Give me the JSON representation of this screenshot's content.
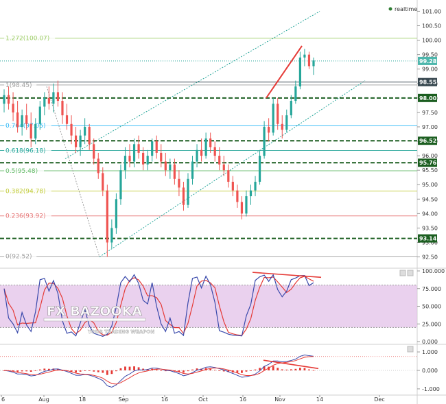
{
  "realtime_label": "realtime",
  "watermark": {
    "brand": "FX BAZOOKA",
    "tagline": "YOUR TRADING WEAPON"
  },
  "colors": {
    "up": "#26a69a",
    "down": "#ef5350",
    "support": "#1b5e20",
    "channel": "#26a69a",
    "trend_red": "#e53935",
    "stoch_k": "#3949ab",
    "stoch_d": "#e53935",
    "stoch_band": "#e1bee7"
  },
  "chart_data": [
    {
      "type": "candlestick",
      "name": "price",
      "y_ticks": [
        "101.00",
        "100.50",
        "100.00",
        "99.50",
        "99.00",
        "98.50",
        "98.00",
        "97.50",
        "97.00",
        "96.50",
        "96.00",
        "95.50",
        "95.00",
        "94.50",
        "94.00",
        "93.50",
        "93.00",
        "92.50"
      ],
      "ylim": [
        92.3,
        101.2
      ],
      "x_ticks": [
        "6",
        "Aug",
        "18",
        "Sep",
        "16",
        "Oct",
        "16",
        "Nov",
        "14",
        "Dec"
      ],
      "last_price": "99.28",
      "fib_levels": [
        {
          "label": "1.272(100.07)",
          "value": 100.07,
          "color": "#9ccc65"
        },
        {
          "label": "1(98.45)",
          "value": 98.45,
          "color": "#9e9e9e"
        },
        {
          "label": "0.764(97.05)",
          "value": 97.05,
          "color": "#29b6f6"
        },
        {
          "label": "0.618(96.18)",
          "value": 96.18,
          "color": "#26a69a"
        },
        {
          "label": "0.5(95.48)",
          "value": 95.48,
          "color": "#66bb6a"
        },
        {
          "label": "0.382(94.78)",
          "value": 94.78,
          "color": "#c0ca33"
        },
        {
          "label": "0.236(93.92)",
          "value": 93.92,
          "color": "#e57373"
        },
        {
          "label": "0(92.52)",
          "value": 92.52,
          "color": "#9e9e9e"
        }
      ],
      "support_levels": [
        {
          "label": "98.55",
          "value": 98.55,
          "color": "#37474f",
          "dashed": false
        },
        {
          "label": "98.00",
          "value": 98.0,
          "color": "#1b5e20",
          "dashed": true
        },
        {
          "label": "96.52",
          "value": 96.52,
          "color": "#1b5e20",
          "dashed": true
        },
        {
          "label": "95.76",
          "value": 95.76,
          "color": "#1b5e20",
          "dashed": true
        },
        {
          "label": "93.14",
          "value": 93.14,
          "color": "#1b5e20",
          "dashed": true
        }
      ],
      "candles": [
        [
          97.8,
          98.3,
          97.5,
          98.1
        ],
        [
          98.1,
          98.4,
          97.6,
          97.8
        ],
        [
          97.8,
          98.2,
          97.2,
          97.5
        ],
        [
          97.5,
          97.9,
          96.8,
          97.0
        ],
        [
          97.0,
          97.6,
          96.7,
          97.4
        ],
        [
          97.4,
          97.8,
          96.9,
          97.1
        ],
        [
          97.1,
          97.5,
          96.3,
          96.6
        ],
        [
          96.6,
          97.3,
          96.4,
          97.1
        ],
        [
          97.1,
          97.9,
          96.9,
          97.7
        ],
        [
          97.7,
          98.2,
          97.4,
          98.0
        ],
        [
          98.0,
          98.4,
          97.6,
          97.8
        ],
        [
          97.8,
          98.5,
          97.5,
          98.2
        ],
        [
          98.2,
          98.6,
          97.7,
          97.9
        ],
        [
          97.9,
          98.2,
          97.1,
          97.4
        ],
        [
          97.4,
          97.8,
          96.9,
          97.1
        ],
        [
          97.1,
          97.4,
          96.4,
          96.7
        ],
        [
          96.7,
          97.0,
          96.1,
          96.3
        ],
        [
          96.3,
          96.9,
          96.0,
          96.7
        ],
        [
          96.7,
          97.3,
          96.4,
          97.0
        ],
        [
          97.0,
          97.1,
          96.2,
          96.4
        ],
        [
          96.4,
          96.6,
          95.7,
          95.9
        ],
        [
          95.9,
          96.1,
          95.2,
          95.4
        ],
        [
          95.4,
          95.6,
          94.6,
          94.8
        ],
        [
          94.8,
          95.0,
          92.5,
          93.0
        ],
        [
          93.0,
          93.8,
          92.8,
          93.5
        ],
        [
          93.5,
          94.7,
          93.3,
          94.5
        ],
        [
          94.5,
          95.7,
          94.3,
          95.5
        ],
        [
          95.5,
          96.3,
          95.2,
          96.0
        ],
        [
          96.0,
          96.4,
          95.6,
          95.8
        ],
        [
          95.8,
          96.6,
          95.6,
          96.4
        ],
        [
          96.4,
          96.7,
          95.9,
          96.1
        ],
        [
          96.1,
          96.3,
          95.5,
          95.7
        ],
        [
          95.7,
          96.2,
          95.5,
          96.0
        ],
        [
          96.0,
          96.6,
          95.8,
          96.5
        ],
        [
          96.5,
          96.7,
          95.9,
          96.1
        ],
        [
          96.1,
          96.4,
          95.6,
          95.8
        ],
        [
          95.8,
          96.1,
          95.3,
          95.5
        ],
        [
          95.5,
          95.9,
          95.2,
          95.7
        ],
        [
          95.7,
          95.9,
          95.0,
          95.2
        ],
        [
          95.2,
          95.5,
          94.6,
          94.9
        ],
        [
          94.9,
          95.1,
          94.1,
          94.3
        ],
        [
          94.3,
          95.4,
          94.2,
          95.2
        ],
        [
          95.2,
          96.0,
          95.0,
          95.8
        ],
        [
          95.8,
          96.4,
          95.6,
          96.2
        ],
        [
          96.2,
          96.6,
          95.8,
          96.0
        ],
        [
          96.0,
          96.8,
          95.9,
          96.6
        ],
        [
          96.6,
          96.8,
          96.1,
          96.3
        ],
        [
          96.3,
          96.5,
          95.8,
          96.0
        ],
        [
          96.0,
          96.3,
          95.5,
          95.7
        ],
        [
          95.7,
          96.0,
          95.3,
          95.5
        ],
        [
          95.5,
          95.7,
          94.9,
          95.1
        ],
        [
          95.1,
          95.3,
          94.6,
          94.8
        ],
        [
          94.8,
          95.0,
          94.2,
          94.4
        ],
        [
          94.4,
          94.6,
          93.8,
          94.0
        ],
        [
          94.0,
          94.8,
          93.9,
          94.6
        ],
        [
          94.6,
          95.0,
          94.3,
          94.8
        ],
        [
          94.8,
          95.3,
          94.6,
          95.1
        ],
        [
          95.1,
          96.2,
          95.0,
          96.0
        ],
        [
          96.0,
          97.2,
          95.9,
          97.0
        ],
        [
          97.0,
          97.3,
          96.5,
          96.8
        ],
        [
          96.8,
          98.0,
          96.7,
          97.8
        ],
        [
          97.8,
          98.0,
          96.9,
          97.1
        ],
        [
          97.1,
          97.4,
          96.6,
          96.9
        ],
        [
          96.9,
          97.6,
          96.8,
          97.4
        ],
        [
          97.4,
          98.1,
          97.3,
          97.9
        ],
        [
          97.9,
          98.6,
          97.8,
          98.4
        ],
        [
          98.4,
          99.6,
          98.3,
          99.4
        ],
        [
          99.4,
          99.7,
          99.1,
          99.5
        ],
        [
          99.5,
          99.6,
          99.0,
          99.1
        ],
        [
          99.1,
          99.4,
          98.8,
          99.3
        ]
      ]
    },
    {
      "type": "line",
      "name": "stochastic",
      "y_ticks": [
        "100.000",
        "75.000",
        "50.000",
        "25.000",
        "0.000"
      ],
      "ylim": [
        0,
        100
      ],
      "band": [
        20,
        80
      ]
    },
    {
      "type": "bar",
      "name": "macd",
      "y_ticks": [
        "1.000",
        "0.000",
        "-1.000"
      ],
      "ylim": [
        -1.3,
        1.3
      ]
    }
  ]
}
